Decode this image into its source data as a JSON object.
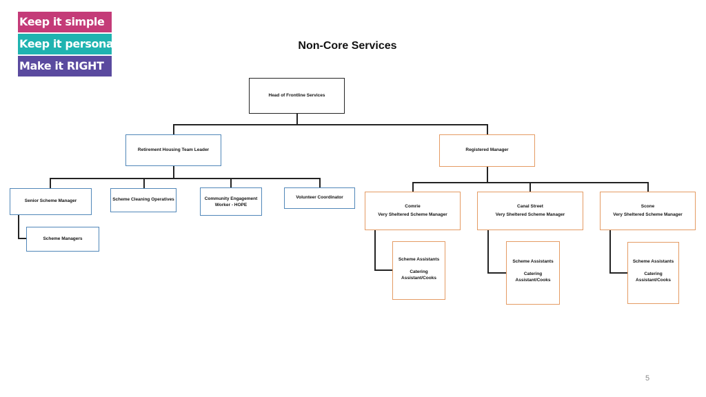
{
  "logo": {
    "lines": [
      {
        "text": "Keep it simple",
        "color": "#c43b78"
      },
      {
        "text": "Keep it personal",
        "color": "#1fb3b0"
      },
      {
        "text": "Make it RIGHT",
        "color": "#5a4a9f"
      }
    ]
  },
  "title": "Non-Core Services",
  "org": {
    "head": "Head of Frontline Services",
    "left_branch": {
      "manager": "Retirement Housing Team Leader",
      "reports": {
        "senior": "Senior Scheme Manager",
        "cleaning": "Scheme Cleaning Operatives",
        "community": [
          "Community Engagement",
          "Worker - HOPE"
        ],
        "volunteer": "Volunteer Coordinator"
      },
      "senior_reports": "Scheme Managers"
    },
    "right_branch": {
      "manager": "Registered Manager",
      "schemes": [
        {
          "location": "Comrie",
          "role": "Very Sheltered Scheme Manager",
          "assistants": "Scheme Assistants",
          "catering": [
            "Catering",
            "Assistant/Cooks"
          ]
        },
        {
          "location": "Canal Street",
          "role": "Very Sheltered Scheme Manager",
          "assistants": "Scheme Assistants",
          "catering": [
            "Catering",
            "Assistant/Cooks"
          ]
        },
        {
          "location": "Scone",
          "role": "Very Sheltered Scheme Manager",
          "assistants": "Scheme Assistants",
          "catering": [
            "Catering",
            "Assistant/Cooks"
          ]
        }
      ]
    }
  },
  "colors": {
    "left_branch_border": "#4f86b8",
    "right_branch_border": "#e49a62",
    "connector": "#222222"
  },
  "page_number": "5"
}
